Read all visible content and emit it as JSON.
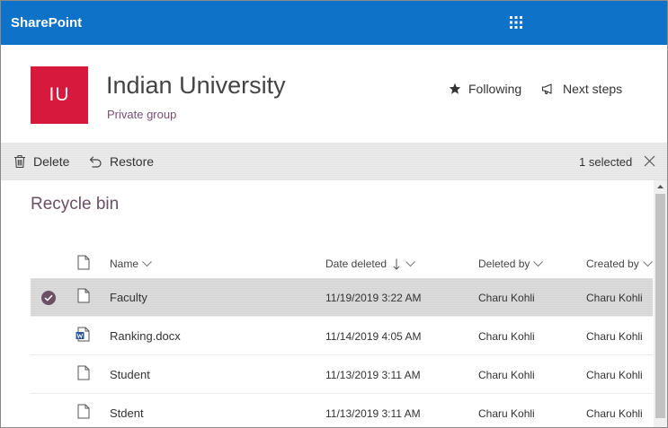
{
  "app": {
    "brand": "SharePoint"
  },
  "site": {
    "logo_text": "IU",
    "title": "Indian University",
    "subtitle": "Private group",
    "following_label": "Following",
    "next_steps_label": "Next steps"
  },
  "commandbar": {
    "delete_label": "Delete",
    "restore_label": "Restore",
    "selected_count": "1 selected"
  },
  "page": {
    "title": "Recycle bin"
  },
  "table": {
    "columns": {
      "name": "Name",
      "date_deleted": "Date deleted",
      "deleted_by": "Deleted by",
      "created_by": "Created by"
    },
    "rows": [
      {
        "name": "Faculty",
        "date_deleted": "11/19/2019 3:22 AM",
        "deleted_by": "Charu Kohli",
        "created_by": "Charu Kohli",
        "icon": "file-icon",
        "selected": true
      },
      {
        "name": "Ranking.docx",
        "date_deleted": "11/14/2019 4:05 AM",
        "deleted_by": "Charu Kohli",
        "created_by": "Charu Kohli",
        "icon": "word-doc-icon",
        "selected": false
      },
      {
        "name": "Student",
        "date_deleted": "11/13/2019 3:11 AM",
        "deleted_by": "Charu Kohli",
        "created_by": "Charu Kohli",
        "icon": "file-icon",
        "selected": false
      },
      {
        "name": "Stdent",
        "date_deleted": "11/13/2019 3:11 AM",
        "deleted_by": "Charu Kohli",
        "created_by": "Charu Kohli",
        "icon": "file-icon",
        "selected": false
      }
    ]
  },
  "colors": {
    "suite_bar": "#0f72c9",
    "site_logo": "#d6193d",
    "accent": "#6b4f63",
    "word_blue": "#2b579a"
  }
}
